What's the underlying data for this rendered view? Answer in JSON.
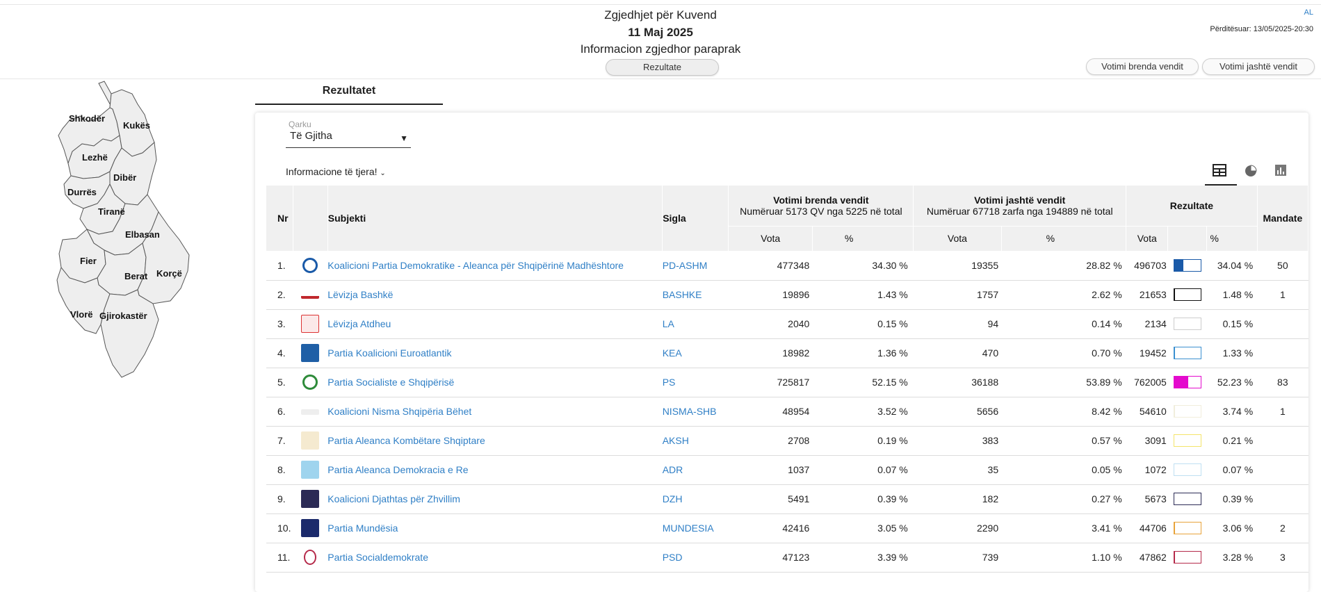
{
  "header": {
    "title": "Zgjedhjet për Kuvend",
    "date": "11 Maj 2025",
    "subtitle": "Informacion zgjedhor paraprak",
    "tab_button": "Rezultate",
    "lang": "AL",
    "updated": "Përditësuar: 13/05/2025-20:30",
    "btn_brenda": "Votimi brenda vendit",
    "btn_jashte": "Votimi jashtë vendit"
  },
  "map": {
    "regions": [
      "Shkodër",
      "Kukës",
      "Lezhë",
      "Dibër",
      "Durrës",
      "Tiranë",
      "Elbasan",
      "Fier",
      "Berat",
      "Korçë",
      "Vlorë",
      "Gjirokastër"
    ]
  },
  "tabs": {
    "results": "Rezultatet"
  },
  "filter": {
    "label": "Qarku",
    "value": "Të Gjitha"
  },
  "info_link": "Informacione të tjera!",
  "table": {
    "headers": {
      "nr": "Nr",
      "subject": "Subjekti",
      "sigla": "Sigla",
      "inside_title": "Votimi brenda vendit",
      "inside_sub": "Numëruar 5173 QV nga 5225 në total",
      "outside_title": "Votimi jashtë vendit",
      "outside_sub": "Numëruar 67718 zarfa nga 194889 në total",
      "results": "Rezultate",
      "mandates": "Mandate",
      "votes": "Vota",
      "pct": "%"
    },
    "rows": [
      {
        "nr": "1.",
        "name": "Koalicioni Partia Demokratike - Aleanca për Shqipërinë Madhështore",
        "sigla": "PD-ASHM",
        "in_votes": "477348",
        "in_pct": "34.30 %",
        "out_votes": "19355",
        "out_pct": "28.82 %",
        "tot_votes": "496703",
        "tot_pct": "34.04 %",
        "mandates": "50",
        "color": "#1a5aa8",
        "share": 0.3404,
        "logo": "pd-logo-icon"
      },
      {
        "nr": "2.",
        "name": "Lëvizja Bashkë",
        "sigla": "BASHKE",
        "in_votes": "19896",
        "in_pct": "1.43 %",
        "out_votes": "1757",
        "out_pct": "2.62 %",
        "tot_votes": "21653",
        "tot_pct": "1.48 %",
        "mandates": "1",
        "color": "#111111",
        "share": 0.0148,
        "logo": "bashke-logo-icon"
      },
      {
        "nr": "3.",
        "name": "Lëvizja Atdheu",
        "sigla": "LA",
        "in_votes": "2040",
        "in_pct": "0.15 %",
        "out_votes": "94",
        "out_pct": "0.14 %",
        "tot_votes": "2134",
        "tot_pct": "0.15 %",
        "mandates": "",
        "color": "#cccccc",
        "share": 0.0015,
        "logo": "la-logo-icon"
      },
      {
        "nr": "4.",
        "name": "Partia Koalicioni Euroatlantik",
        "sigla": "KEA",
        "in_votes": "18982",
        "in_pct": "1.36 %",
        "out_votes": "470",
        "out_pct": "0.70 %",
        "tot_votes": "19452",
        "tot_pct": "1.33 %",
        "mandates": "",
        "color": "#3a8fd0",
        "share": 0.0133,
        "logo": "kea-logo-icon"
      },
      {
        "nr": "5.",
        "name": "Partia Socialiste e Shqipërisë",
        "sigla": "PS",
        "in_votes": "725817",
        "in_pct": "52.15 %",
        "out_votes": "36188",
        "out_pct": "53.89 %",
        "tot_votes": "762005",
        "tot_pct": "52.23 %",
        "mandates": "83",
        "color": "#e40acd",
        "share": 0.5223,
        "logo": "ps-logo-icon"
      },
      {
        "nr": "6.",
        "name": "Koalicioni Nisma Shqipëria Bëhet",
        "sigla": "NISMA-SHB",
        "in_votes": "48954",
        "in_pct": "3.52 %",
        "out_votes": "5656",
        "out_pct": "8.42 %",
        "tot_votes": "54610",
        "tot_pct": "3.74 %",
        "mandates": "1",
        "color": "#f1eedc",
        "share": 0.0374,
        "logo": "nisma-logo-icon"
      },
      {
        "nr": "7.",
        "name": "Partia Aleanca Kombëtare Shqiptare",
        "sigla": "AKSH",
        "in_votes": "2708",
        "in_pct": "0.19 %",
        "out_votes": "383",
        "out_pct": "0.57 %",
        "tot_votes": "3091",
        "tot_pct": "0.21 %",
        "mandates": "",
        "color": "#f4e46a",
        "share": 0.0021,
        "logo": "aksh-logo-icon"
      },
      {
        "nr": "8.",
        "name": "Partia Aleanca Demokracia e Re",
        "sigla": "ADR",
        "in_votes": "1037",
        "in_pct": "0.07 %",
        "out_votes": "35",
        "out_pct": "0.05 %",
        "tot_votes": "1072",
        "tot_pct": "0.07 %",
        "mandates": "",
        "color": "#bfe0f2",
        "share": 0.0007,
        "logo": "adr-logo-icon"
      },
      {
        "nr": "9.",
        "name": "Koalicioni Djathtas për Zhvillim",
        "sigla": "DZH",
        "in_votes": "5491",
        "in_pct": "0.39 %",
        "out_votes": "182",
        "out_pct": "0.27 %",
        "tot_votes": "5673",
        "tot_pct": "0.39 %",
        "mandates": "",
        "color": "#2b2a55",
        "share": 0.0039,
        "logo": "dzh-logo-icon"
      },
      {
        "nr": "10.",
        "name": "Partia Mundësia",
        "sigla": "MUNDESIA",
        "in_votes": "42416",
        "in_pct": "3.05 %",
        "out_votes": "2290",
        "out_pct": "3.41 %",
        "tot_votes": "44706",
        "tot_pct": "3.06 %",
        "mandates": "2",
        "color": "#e8a33a",
        "share": 0.0306,
        "logo": "mundesia-logo-icon"
      },
      {
        "nr": "11.",
        "name": "Partia Socialdemokrate",
        "sigla": "PSD",
        "in_votes": "47123",
        "in_pct": "3.39 %",
        "out_votes": "739",
        "out_pct": "1.10 %",
        "tot_votes": "47862",
        "tot_pct": "3.28 %",
        "mandates": "3",
        "color": "#b52a4a",
        "share": 0.0328,
        "logo": "psd-logo-icon"
      }
    ]
  }
}
